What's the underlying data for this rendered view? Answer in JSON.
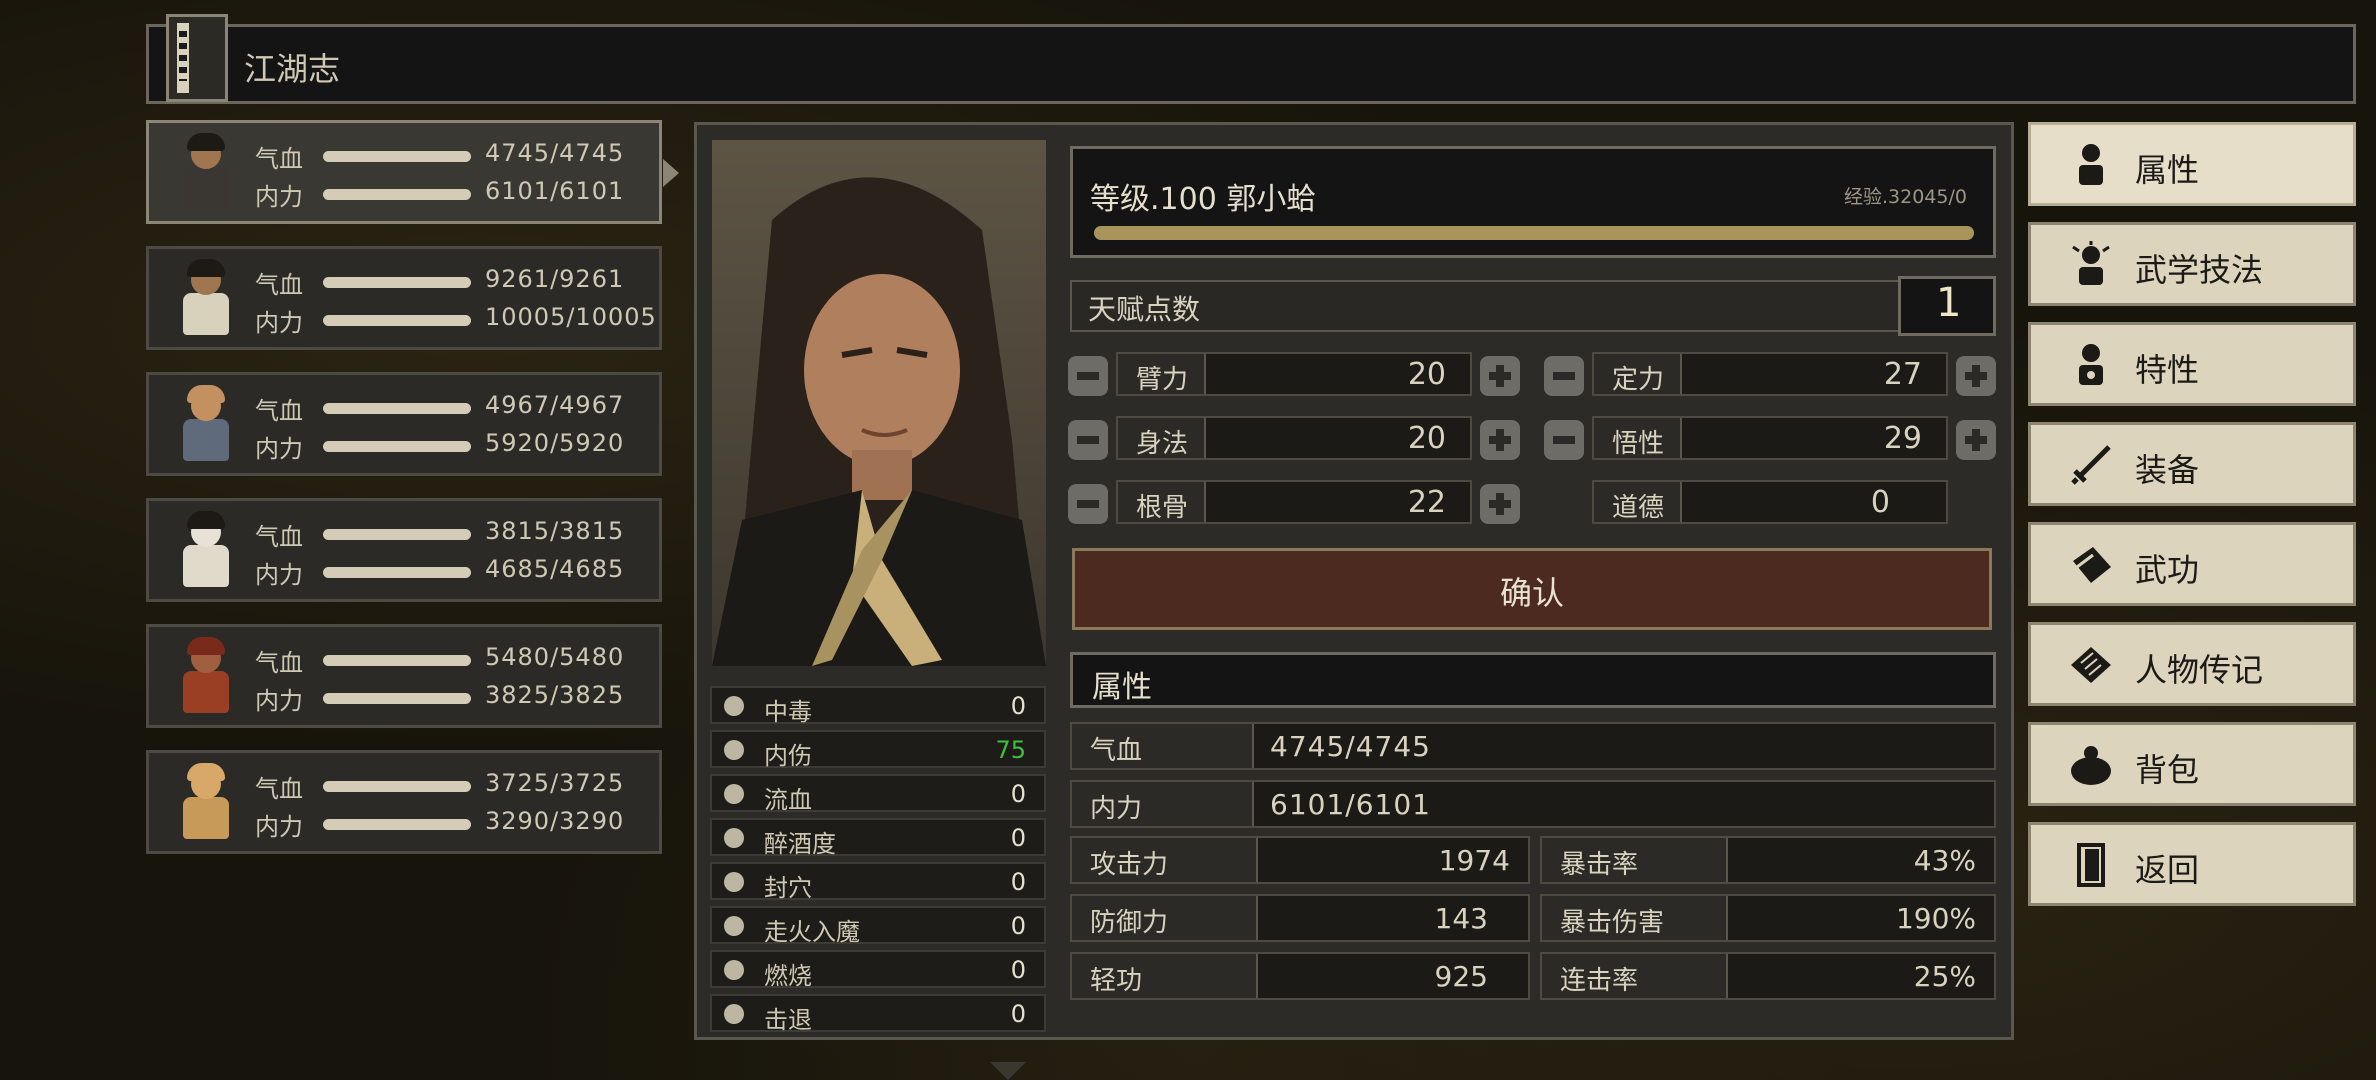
{
  "title": "江湖志",
  "party": [
    {
      "hp_label": "气血",
      "hp": "4745/4745",
      "mp_label": "内力",
      "mp": "6101/6101",
      "selected": true
    },
    {
      "hp_label": "气血",
      "hp": "9261/9261",
      "mp_label": "内力",
      "mp": "10005/10005",
      "selected": false
    },
    {
      "hp_label": "气血",
      "hp": "4967/4967",
      "mp_label": "内力",
      "mp": "5920/5920",
      "selected": false
    },
    {
      "hp_label": "气血",
      "hp": "3815/3815",
      "mp_label": "内力",
      "mp": "4685/4685",
      "selected": false
    },
    {
      "hp_label": "气血",
      "hp": "5480/5480",
      "mp_label": "内力",
      "mp": "3825/3825",
      "selected": false
    },
    {
      "hp_label": "气血",
      "hp": "3725/3725",
      "mp_label": "内力",
      "mp": "3290/3290",
      "selected": false
    }
  ],
  "character": {
    "level_line": "等级.100 郭小蛤",
    "exp": "经验.32045/0",
    "exp_fraction": 1.0
  },
  "talent": {
    "label": "天赋点数",
    "value": "1"
  },
  "attributes": {
    "arm": {
      "name": "臂力",
      "value": "20"
    },
    "focus": {
      "name": "定力",
      "value": "27"
    },
    "agility": {
      "name": "身法",
      "value": "20"
    },
    "insight": {
      "name": "悟性",
      "value": "29"
    },
    "bone": {
      "name": "根骨",
      "value": "22"
    },
    "morality": {
      "name": "道德",
      "value": "0"
    }
  },
  "confirm_label": "确认",
  "section_title": "属性",
  "stats": {
    "hp": {
      "label": "气血",
      "value": "4745/4745"
    },
    "mp": {
      "label": "内力",
      "value": "6101/6101"
    },
    "attack": {
      "label": "攻击力",
      "value": "1974"
    },
    "crit_rate": {
      "label": "暴击率",
      "value": "43%"
    },
    "defense": {
      "label": "防御力",
      "value": "143"
    },
    "crit_dmg": {
      "label": "暴击伤害",
      "value": "190%"
    },
    "qinggong": {
      "label": "轻功",
      "value": "925"
    },
    "combo": {
      "label": "连击率",
      "value": "25%"
    }
  },
  "effects": [
    {
      "name": "中毒",
      "value": "0",
      "icon": "skull-icon"
    },
    {
      "name": "内伤",
      "value": "75",
      "icon": "broken-heart-icon",
      "highlight": "#3fbf3f"
    },
    {
      "name": "流血",
      "value": "0",
      "icon": "blood-icon"
    },
    {
      "name": "醉酒度",
      "value": "0",
      "icon": "drunk-icon"
    },
    {
      "name": "封穴",
      "value": "0",
      "icon": "seal-icon"
    },
    {
      "name": "走火入魔",
      "value": "0",
      "icon": "demon-icon"
    },
    {
      "name": "燃烧",
      "value": "0",
      "icon": "fire-icon"
    },
    {
      "name": "击退",
      "value": "0",
      "icon": "knockback-icon"
    }
  ],
  "menu": [
    {
      "label": "属性",
      "icon": "attribute-icon",
      "active": true
    },
    {
      "label": "武学技法",
      "icon": "martial-skill-icon",
      "active": false
    },
    {
      "label": "特性",
      "icon": "trait-icon",
      "active": false
    },
    {
      "label": "装备",
      "icon": "sword-icon",
      "active": false
    },
    {
      "label": "武功",
      "icon": "manual-book-icon",
      "active": false
    },
    {
      "label": "人物传记",
      "icon": "biography-icon",
      "active": false
    },
    {
      "label": "背包",
      "icon": "bag-icon",
      "active": false
    },
    {
      "label": "返回",
      "icon": "door-icon",
      "active": false
    }
  ]
}
